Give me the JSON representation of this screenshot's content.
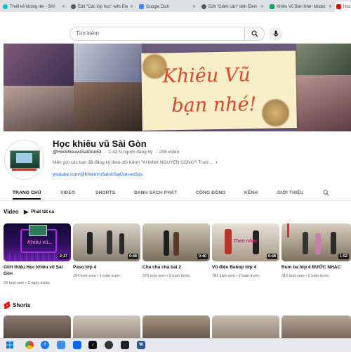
{
  "browser": {
    "tabs": [
      {
        "label": "Thiết kế không tên - 500",
        "color": "#00c4cc"
      },
      {
        "label": "Edit \"Các lớp học\" with Ele",
        "color": "#555555"
      },
      {
        "label": "Google Dịch",
        "color": "#4285f4"
      },
      {
        "label": "Edit \"Giảm cân\" with Elem",
        "color": "#555555"
      },
      {
        "label": "Khiêu Vũ Bạn Nhé! Moder",
        "color": "#1aa260"
      },
      {
        "label": "Học",
        "color": "#ff0000"
      }
    ]
  },
  "search": {
    "placeholder": "Tìm kiếm"
  },
  "banner": {
    "line1": "Khiêu Vũ",
    "line2": "bạn nhé!"
  },
  "channel": {
    "name": "Học khiêu vũ Sài Gòn",
    "handle": "@HockhieuvuSaiGon63",
    "subscribers": "2,43 N người đăng ký",
    "video_count": "208 video",
    "description": "Mến gửi các bạn đã đăng ký theo dõi Kênh \"KHANH NGUYEN CONG\"! Trướ...",
    "link": "youtube.com/@KhieuVuSalonSaiGon-ex5uo"
  },
  "tabs": [
    "TRANG CHỦ",
    "VIDEO",
    "SHORTS",
    "DANH SÁCH PHÁT",
    "CỘNG ĐỒNG",
    "KÊNH",
    "GIỚI THIỆU"
  ],
  "videos_section": {
    "title": "Video",
    "play_all": "Phát tất cả"
  },
  "videos": [
    {
      "title": "Giới thiệu Học khiêu vũ Sài Gòn",
      "duration": "2:17",
      "views": "26 lượt xem",
      "age": "2 ngày trước",
      "overlay": "Khiêu vũ..."
    },
    {
      "title": "Paso lớp 4",
      "duration": "0:48",
      "views": "194 lượt xem",
      "age": "2 tuần trước"
    },
    {
      "title": "Cha cha cha bài 2",
      "duration": "0:40",
      "views": "373 lượt xem",
      "age": "2 tuần trước"
    },
    {
      "title": "Vũ điệu Bebop lớp 4",
      "duration": "0:48",
      "views": "781 lượt xem",
      "age": "2 tuần trước",
      "overlay": "Theo nhạc"
    },
    {
      "title": "Rum ba lớp 4 BƯỚC NHẠC",
      "duration": "1:52",
      "views": "315 lượt xem",
      "age": "2 tuần trước"
    }
  ],
  "shorts_section": {
    "title": "Shorts"
  },
  "colors": {
    "brand_red": "#ff0000",
    "link_blue": "#065fd4",
    "text_secondary": "#606060",
    "banner_title": "#e0442c"
  }
}
